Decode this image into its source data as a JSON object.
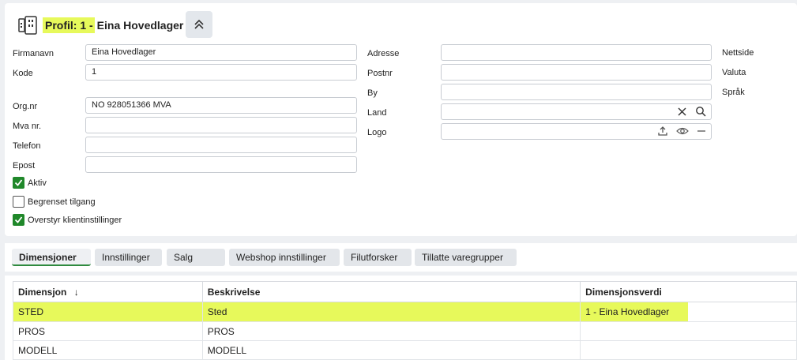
{
  "header": {
    "title_highlight": "Profil: 1 -",
    "title_rest": "Eina Hovedlager"
  },
  "form": {
    "left": [
      {
        "label": "Firmanavn",
        "value": "Eina Hovedlager"
      },
      {
        "label": "Kode",
        "value": "1"
      },
      {
        "label": "Org.nr",
        "value": "NO 928051366 MVA"
      },
      {
        "label": "Mva nr.",
        "value": ""
      },
      {
        "label": "Telefon",
        "value": ""
      },
      {
        "label": "Epost",
        "value": ""
      }
    ],
    "middle": [
      {
        "label": "Adresse",
        "value": ""
      },
      {
        "label": "Postnr",
        "value": ""
      },
      {
        "label": "By",
        "value": ""
      },
      {
        "label": "Land",
        "value": ""
      },
      {
        "label": "Logo",
        "value": ""
      }
    ],
    "right": [
      {
        "label": "Nettside"
      },
      {
        "label": "Valuta"
      },
      {
        "label": "Språk"
      }
    ],
    "checkboxes": [
      {
        "label": "Aktiv",
        "checked": true
      },
      {
        "label": "Begrenset tilgang",
        "checked": false
      },
      {
        "label": "Overstyr klientinstillinger",
        "checked": true
      }
    ]
  },
  "tabs": [
    "Dimensjoner",
    "Innstillinger",
    "Salg",
    "Webshop innstillinger",
    "Filutforsker",
    "Tillatte varegrupper"
  ],
  "table": {
    "columns": [
      "Dimensjon",
      "Beskrivelse",
      "Dimensjonsverdi"
    ],
    "sort_indicator": "↓",
    "rows": [
      [
        "STED",
        "Sted",
        "1 - Eina Hovedlager"
      ],
      [
        "PROS",
        "PROS",
        ""
      ],
      [
        "MODELL",
        "MODELL",
        ""
      ]
    ]
  },
  "colors": {
    "highlight": "#e7f95b",
    "checkbox_checked": "#20882a",
    "tab_active_underline": "#2f8a3f"
  },
  "icons": {
    "profile": "profile-card-icon",
    "collapse": "chevron-double-up-icon",
    "clear": "close-icon",
    "search": "search-icon",
    "upload": "upload-icon",
    "view": "eye-icon",
    "remove": "minus-icon",
    "check": "checkmark-icon",
    "sort": "sort-desc-icon"
  }
}
